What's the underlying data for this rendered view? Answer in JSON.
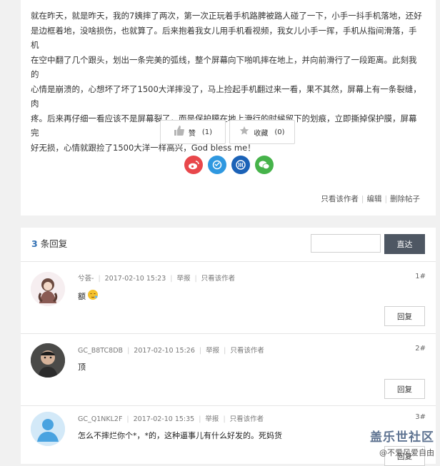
{
  "post": {
    "paragraphs": [
      "就在昨天，就是昨天，我的7姨摔了两次，第一次正玩着手机路脾被路人碰了一下，小手一抖手机落地，还好",
      "是边框着地，没啥损伤，也就算了。后来抱着我女儿用手机看视频，我女儿小手一挥，手机从指间滑落，手机",
      "在空中翻了几个跟头，划出一条完美的弧线，整个屏幕向下啪叽摔在地上，并向前滑行了一段距离。此刻我的",
      "心情是崩溃的，心想坏了坏了1500大洋摔没了，马上捡起手机翻过来一看，果不其然，屏幕上有一条裂缝，肉",
      "疼。后来再仔细一看应该不是屏幕裂了，而是保护膜在地上滑行的时候留下的划痕，立即撕掉保护膜，屏幕完",
      "好无损，心情就跟捡了1500大洋一样高兴，God bless me！"
    ],
    "like": {
      "label": "赞",
      "count": "(1)",
      "icon": "thumbs-up-icon"
    },
    "fav": {
      "label": "收藏",
      "count": "(0)",
      "icon": "star-icon"
    },
    "share_icons": [
      "weibo-icon",
      "qzone-icon",
      "renren-icon",
      "wechat-icon"
    ],
    "actions": [
      "只看该作者",
      "编辑",
      "删除帖子"
    ]
  },
  "replies_section": {
    "count": "3",
    "label": "条回复",
    "jump_button": "直达",
    "jump_placeholder": ""
  },
  "replies": [
    {
      "user": "兮荟-",
      "time": "2017-02-10 15:23",
      "report": "举报",
      "only_author": "只看该作者",
      "floor": "1#",
      "content": "额",
      "reply_button": "回复"
    },
    {
      "user": "GC_B8TC8DB",
      "time": "2017-02-10 15:26",
      "report": "举报",
      "only_author": "只看该作者",
      "floor": "2#",
      "content": "顶",
      "reply_button": "回复"
    },
    {
      "user": "GC_Q1NKL2F",
      "time": "2017-02-10 15:35",
      "report": "举报",
      "only_author": "只看该作者",
      "floor": "3#",
      "content": "怎么不摔烂你个*，*的，这种逼事儿有什么好发的。死妈货",
      "reply_button": "回复"
    }
  ],
  "watermark": {
    "logo": "盖乐世社区",
    "handle": "@不爱风爱自由"
  },
  "colors": {
    "accent_blue": "#3271b4",
    "dark_button": "#4e5763",
    "weibo": "#e8474b",
    "qzone": "#2f98e0",
    "renren": "#1b62b7",
    "wechat": "#46b34a"
  }
}
